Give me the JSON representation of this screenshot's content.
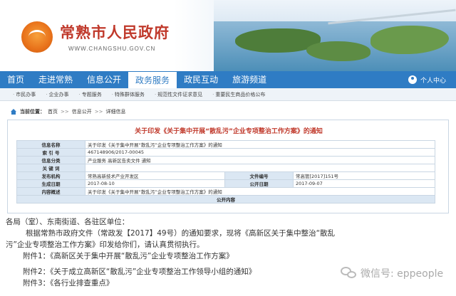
{
  "header": {
    "site_title": "常熟市人民政府",
    "site_url": "WWW.CHANGSHU.GOV.CN"
  },
  "main_nav": {
    "items": [
      "首页",
      "走进常熟",
      "信息公开",
      "政务服务",
      "政民互动",
      "旅游频道"
    ],
    "active": "政务服务",
    "user_center": "个人中心"
  },
  "sub_nav": {
    "items": [
      "市民办事",
      "企业办事",
      "专题服务",
      "特殊群体服务",
      "规范性文件证求意见",
      "重要民生商品价格公布"
    ]
  },
  "breadcrumb": {
    "label": "当前位置：",
    "items": [
      "首页",
      "信息公开",
      "详细信息"
    ]
  },
  "document": {
    "title": "关于印发《关于集中开展“散乱污”企业专项整治工作方案》的通知",
    "meta": {
      "info_name_label": "信息名称",
      "info_name": "关于印发《关于集中开展“散乱污”企业专项整治工作方案》的通知",
      "index_label": "索 引 号",
      "index": "467148906/2017-00045",
      "category_label": "信息分类",
      "category": "产业服务  高新区告卖文件  通知",
      "keywords_label": "关 键 词",
      "keywords": "",
      "issuer_label": "发布机构",
      "issuer": "常熟高新技术产业开发区",
      "doc_no_label": "文件编号",
      "doc_no": "常高管[2017]151号",
      "date_label": "生成日期",
      "date": "2017-08-10",
      "public_date_label": "公开日期",
      "public_date": "2017-09-07",
      "summary_label": "内容概述",
      "summary": "关于印发《关于集中开展“散乱污”企业专项整治工作方案》的通知",
      "public_content_label": "公开内容"
    }
  },
  "body": {
    "greeting": "各局（室）、东南街道、各驻区单位：",
    "para_1": "根据常熟市政府文件（常政发【2017】49号）的通知要求，现将《高新区关于集中整治“散乱",
    "para_2": "污”企业专项整治工作方案》印发给你们，请认真贯彻执行。",
    "attachment_1": "附件1：《高新区关于集中开展“散乱污”企业专项整治工作方案》",
    "attachment_2": "附件2：《关于成立高新区“散乱污”企业专项整治工作领导小组的通知》",
    "attachment_3": "附件3：《各行业排查重点》"
  },
  "watermark": {
    "text": "微信号: eppeople"
  }
}
